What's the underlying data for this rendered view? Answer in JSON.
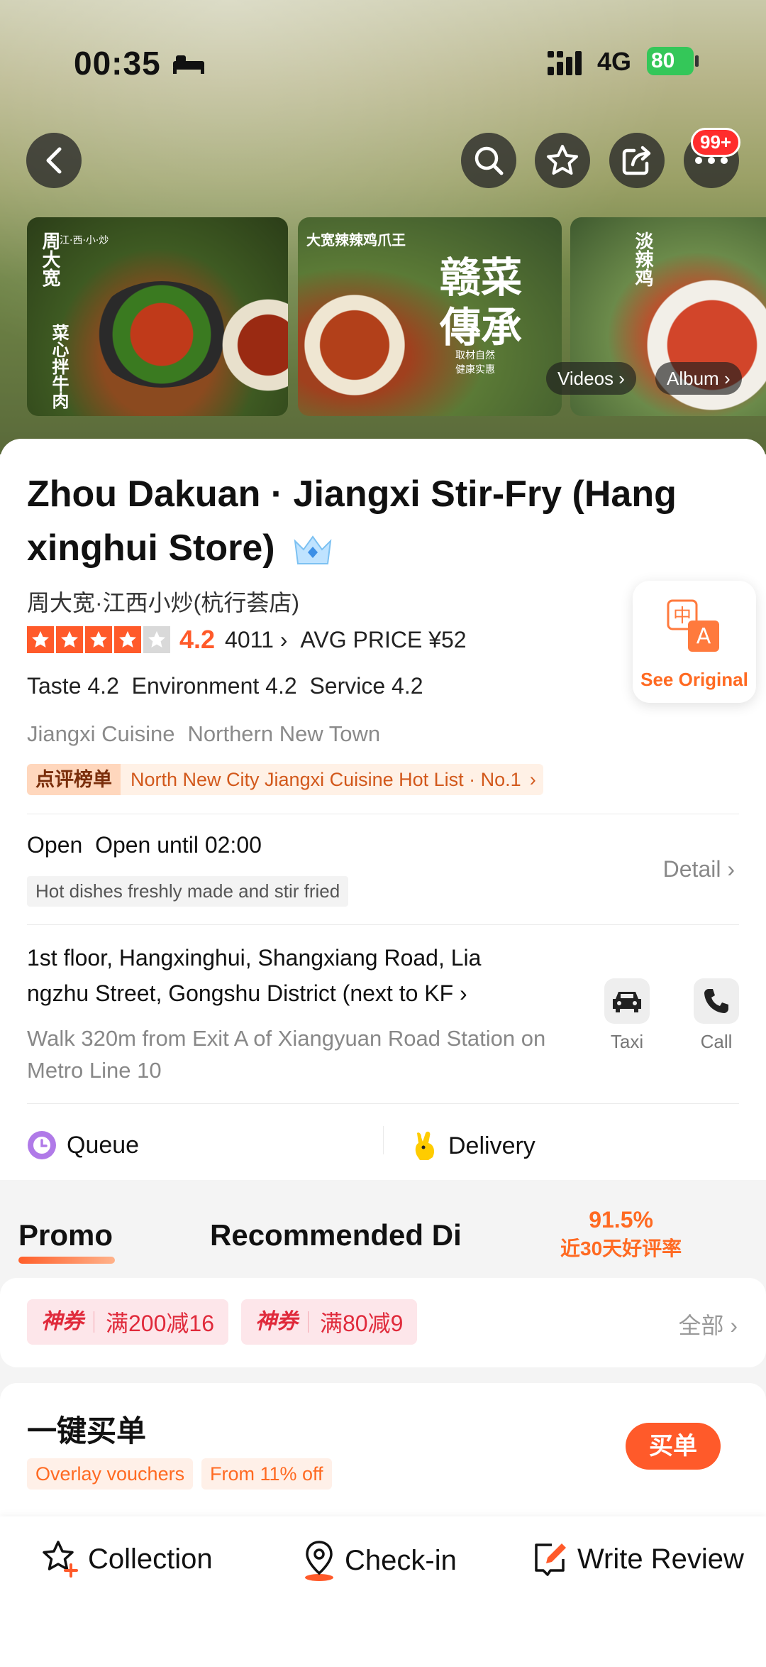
{
  "status": {
    "time": "00:35",
    "network": "4G",
    "battery": "80"
  },
  "nav": {
    "more_badge": "99+"
  },
  "gallery": {
    "photo1_caption": "周大宽",
    "photo1_sub": "江·西·小·炒",
    "photo1_side": "菜心拌牛肉",
    "photo2_caption": "大宽辣辣鸡爪王",
    "photo2_big": "赣菜傳承",
    "photo2_sub": "取材自然 健康实惠",
    "photo3_caption": "淡辣鸡",
    "videos_label": "Videos",
    "album_label": "Album"
  },
  "shop": {
    "title": "Zhou Dakuan · Jiangxi Stir-Fry (Hangxinghui Store)",
    "title_line1": "Zhou Dakuan · Jiangxi Stir-Fry (Hang",
    "title_line2": "xinghui Store)",
    "cn_name": "周大宽·江西小炒(杭行荟店)",
    "rating": "4.2",
    "reviews": "4011",
    "avg_price": "AVG PRICE ¥52",
    "sub_scores": "Taste 4.2  Environment 4.2  Service 4.2",
    "tag1": "Jiangxi Cuisine",
    "tag2": "Northern New Town",
    "hotlist_tag": "点评榜单",
    "hotlist_text": "North New City Jiangxi Cuisine Hot List · No.1",
    "translate_label": "See Original",
    "hours": "Open  Open until 02:00",
    "hours_note": "Hot dishes freshly made and stir fried",
    "detail_label": "Detail",
    "address_line1": "1st floor, Hangxinghui, Shangxiang Road, Lia",
    "address_line2": "ngzhu Street, Gongshu District (next to KF",
    "walk": "Walk 320m from Exit A of Xiangyuan Road Station on Metro Line 10",
    "taxi_label": "Taxi",
    "call_label": "Call",
    "queue_label": "Queue",
    "delivery_label": "Delivery"
  },
  "tabs": {
    "promo": "Promo",
    "recommended": "Recommended Di",
    "good_rate": "91.5%",
    "good_rate_label": "近30天好评率"
  },
  "coupons": {
    "items": [
      {
        "tag": "神券",
        "amount": "满200减16"
      },
      {
        "tag": "神券",
        "amount": "满80减9"
      }
    ],
    "all_label": "全部"
  },
  "buy": {
    "title": "一键买单",
    "tag1": "Overlay vouchers",
    "tag2": "From 11% off",
    "button": "买单"
  },
  "bottom": {
    "collection": "Collection",
    "checkin": "Check-in",
    "review": "Write Review"
  }
}
